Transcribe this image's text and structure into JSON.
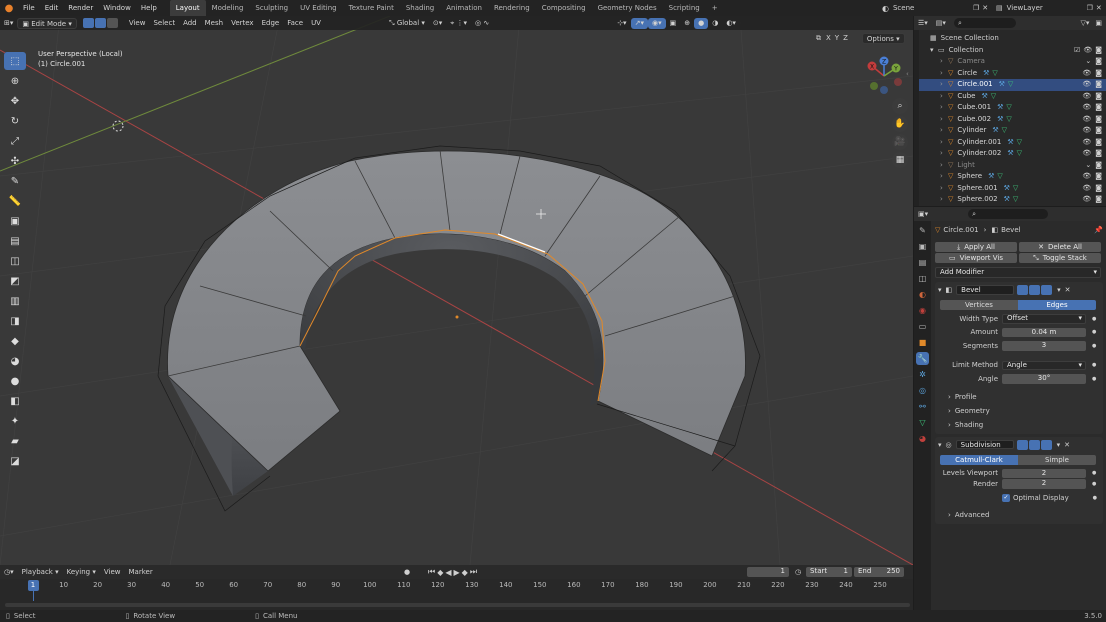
{
  "menu": {
    "file": "File",
    "edit": "Edit",
    "render": "Render",
    "window": "Window",
    "help": "Help"
  },
  "workspaces": [
    "Layout",
    "Modeling",
    "Sculpting",
    "UV Editing",
    "Texture Paint",
    "Shading",
    "Animation",
    "Rendering",
    "Compositing",
    "Geometry Nodes",
    "Scripting"
  ],
  "scene": {
    "label": "Scene",
    "view_layer": "ViewLayer"
  },
  "viewport_header": {
    "mode": "Edit Mode",
    "view": "View",
    "select": "Select",
    "add": "Add",
    "mesh": "Mesh",
    "vertex": "Vertex",
    "edge": "Edge",
    "face": "Face",
    "uv": "UV",
    "orientation": "Global",
    "axes": [
      "X",
      "Y",
      "Z"
    ],
    "options": "Options"
  },
  "overlay_text": {
    "perspective": "User Perspective (Local)",
    "object": "(1) Circle.001"
  },
  "gizmo": {
    "x": "X",
    "y": "Y",
    "z": "Z"
  },
  "outliner": {
    "root": "Scene Collection",
    "collection": "Collection",
    "items": [
      {
        "name": "Camera",
        "dim": true
      },
      {
        "name": "Circle"
      },
      {
        "name": "Circle.001",
        "selected": true
      },
      {
        "name": "Cube"
      },
      {
        "name": "Cube.001"
      },
      {
        "name": "Cube.002"
      },
      {
        "name": "Cylinder"
      },
      {
        "name": "Cylinder.001"
      },
      {
        "name": "Cylinder.002"
      },
      {
        "name": "Light",
        "dim": true
      },
      {
        "name": "Sphere"
      },
      {
        "name": "Sphere.001"
      },
      {
        "name": "Sphere.002"
      }
    ]
  },
  "properties": {
    "breadcrumb_object": "Circle.001",
    "breadcrumb_modifier": "Bevel",
    "apply_all": "Apply All",
    "delete_all": "Delete All",
    "viewport_vis": "Viewport Vis",
    "toggle_stack": "Toggle Stack",
    "add_modifier": "Add Modifier",
    "bevel": {
      "name": "Bevel",
      "vertices": "Vertices",
      "edges": "Edges",
      "width_type_label": "Width Type",
      "width_type": "Offset",
      "amount_label": "Amount",
      "amount": "0.04 m",
      "segments_label": "Segments",
      "segments": "3",
      "limit_method_label": "Limit Method",
      "limit_method": "Angle",
      "angle_label": "Angle",
      "angle": "30°",
      "profile": "Profile",
      "geometry": "Geometry",
      "shading": "Shading"
    },
    "subdivision": {
      "name": "Subdivision",
      "catmull": "Catmull-Clark",
      "simple": "Simple",
      "levels_label": "Levels Viewport",
      "levels": "2",
      "render_label": "Render",
      "render": "2",
      "optimal": "Optimal Display",
      "advanced": "Advanced"
    }
  },
  "timeline": {
    "playback": "Playback",
    "keying": "Keying",
    "view": "View",
    "marker": "Marker",
    "current_frame": "1",
    "start_label": "Start",
    "start": "1",
    "end_label": "End",
    "end": "250",
    "ticks": [
      "1",
      "10",
      "20",
      "30",
      "40",
      "50",
      "60",
      "70",
      "80",
      "90",
      "100",
      "110",
      "120",
      "130",
      "140",
      "150",
      "160",
      "170",
      "180",
      "190",
      "200",
      "210",
      "220",
      "230",
      "240",
      "250"
    ]
  },
  "status": {
    "select": "Select",
    "rotate": "Rotate View",
    "call_menu": "Call Menu",
    "version": "3.5.0"
  },
  "colors": {
    "accent": "#4772b3",
    "selected_row": "#334d80",
    "edge_highlight": "#e0892a",
    "x_axis": "#c43c3c",
    "y_axis": "#7aa43c"
  }
}
